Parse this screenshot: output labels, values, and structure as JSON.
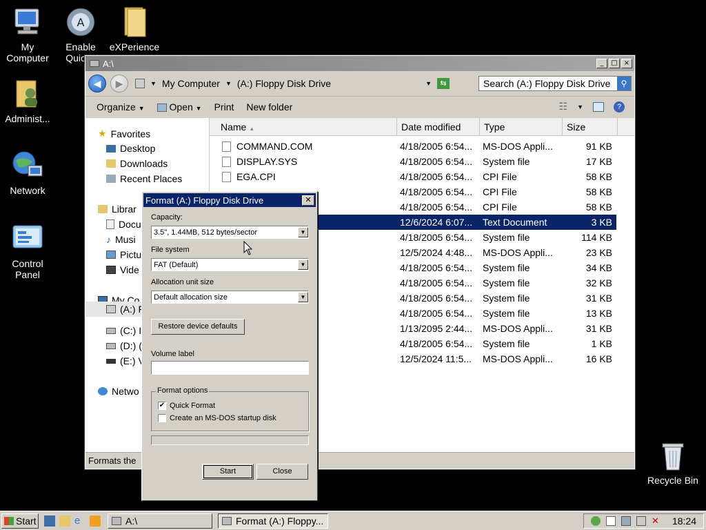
{
  "desktop": {
    "icons": [
      {
        "label": "My Computer"
      },
      {
        "label": "Enable QuickL"
      },
      {
        "label": "eXPerience"
      },
      {
        "label": "Administ..."
      },
      {
        "label": "Network"
      },
      {
        "label": "Control Panel"
      },
      {
        "label": "Recycle Bin"
      }
    ]
  },
  "explorer": {
    "title": "A:\\",
    "breadcrumb": [
      "My Computer",
      "(A:) Floppy Disk Drive"
    ],
    "search_placeholder": "Search (A:) Floppy Disk Drive",
    "toolbar": {
      "organize": "Organize",
      "open": "Open",
      "print": "Print",
      "new_folder": "New folder"
    },
    "nav": {
      "favorites": "Favorites",
      "desktop": "Desktop",
      "downloads": "Downloads",
      "recent": "Recent Places",
      "libraries": "Librar",
      "documents": "Docu",
      "music": "Musi",
      "pictures": "Pictu",
      "videos": "Vide",
      "my_computer": "My Co",
      "a_drive": "(A:) F",
      "c_drive": "(C:) I",
      "d_drive": "(D:) (",
      "e_drive": "(E:) V",
      "network": "Netwo"
    },
    "columns": {
      "name": "Name",
      "date": "Date modified",
      "type": "Type",
      "size": "Size"
    },
    "files": [
      {
        "name": "COMMAND.COM",
        "date": "4/18/2005 6:54...",
        "type": "MS-DOS Appli...",
        "size": "91 KB"
      },
      {
        "name": "DISPLAY.SYS",
        "date": "4/18/2005 6:54...",
        "type": "System file",
        "size": "17 KB"
      },
      {
        "name": "EGA.CPI",
        "date": "4/18/2005 6:54...",
        "type": "CPI File",
        "size": "58 KB"
      },
      {
        "name": "",
        "date": "4/18/2005 6:54...",
        "type": "CPI File",
        "size": "58 KB"
      },
      {
        "name": "",
        "date": "4/18/2005 6:54...",
        "type": "CPI File",
        "size": "58 KB"
      },
      {
        "name": "",
        "date": "12/6/2024 6:07...",
        "type": "Text Document",
        "size": "3 KB"
      },
      {
        "name": "",
        "date": "4/18/2005 6:54...",
        "type": "System file",
        "size": "114 KB"
      },
      {
        "name": "",
        "date": "12/5/2024 4:48...",
        "type": "MS-DOS Appli...",
        "size": "23 KB"
      },
      {
        "name": "",
        "date": "4/18/2005 6:54...",
        "type": "System file",
        "size": "34 KB"
      },
      {
        "name": "",
        "date": "4/18/2005 6:54...",
        "type": "System file",
        "size": "32 KB"
      },
      {
        "name": "",
        "date": "4/18/2005 6:54...",
        "type": "System file",
        "size": "31 KB"
      },
      {
        "name": "",
        "date": "4/18/2005 6:54...",
        "type": "System file",
        "size": "13 KB"
      },
      {
        "name": "",
        "date": "1/13/2095 2:44...",
        "type": "MS-DOS Appli...",
        "size": "31 KB"
      },
      {
        "name": "",
        "date": "4/18/2005 6:54...",
        "type": "System file",
        "size": "1 KB"
      },
      {
        "name": "",
        "date": "12/5/2024 11:5...",
        "type": "MS-DOS Appli...",
        "size": "16 KB"
      }
    ],
    "status": "Formats the"
  },
  "format_dialog": {
    "title": "Format (A:) Floppy Disk Drive",
    "capacity_label": "Capacity:",
    "capacity_value": "3.5\",  1.44MB, 512 bytes/sector",
    "filesystem_label": "File system",
    "filesystem_value": "FAT (Default)",
    "alloc_label": "Allocation unit size",
    "alloc_value": "Default allocation size",
    "restore_button": "Restore device defaults",
    "volume_label": "Volume label",
    "volume_value": "",
    "options_title": "Format options",
    "quick_format": "Quick Format",
    "quick_format_checked": true,
    "msdos_startup": "Create an MS-DOS startup disk",
    "msdos_startup_checked": false,
    "start_button": "Start",
    "close_button": "Close"
  },
  "taskbar": {
    "start": "Start",
    "tasks": [
      {
        "label": "A:\\"
      },
      {
        "label": "Format (A:) Floppy..."
      }
    ],
    "clock": "18:24"
  },
  "colors": {
    "selection": "#0a246a",
    "dialog_title": "#0a246a",
    "window_face": "#d4d0c8"
  }
}
